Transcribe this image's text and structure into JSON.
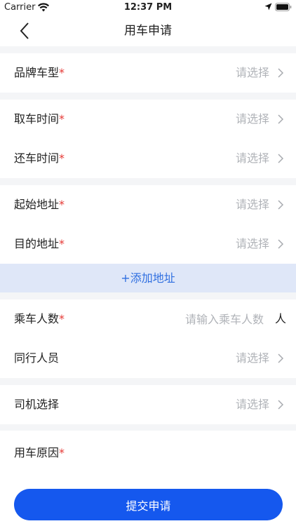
{
  "status_bar": {
    "carrier": "Carrier",
    "time": "12:37 PM"
  },
  "header": {
    "title": "用车申请"
  },
  "colors": {
    "accent": "#1558ee",
    "required": "#e53935",
    "add_address_bg": "#dfe7f8",
    "add_address_text": "#2f6fe0",
    "placeholder": "#b0b3b8"
  },
  "form": {
    "brand_model": {
      "label": "品牌车型",
      "required_mark": "*",
      "value": "请选择"
    },
    "pickup_time": {
      "label": "取车时间",
      "required_mark": "*",
      "value": "请选择"
    },
    "return_time": {
      "label": "还车时间",
      "required_mark": "*",
      "value": "请选择"
    },
    "start_address": {
      "label": "起始地址",
      "required_mark": "*",
      "value": "请选择"
    },
    "destination": {
      "label": "目的地址",
      "required_mark": "*",
      "value": "请选择"
    },
    "add_address_label": "+添加地址",
    "passenger_count": {
      "label": "乘车人数",
      "required_mark": "*",
      "placeholder": "请输入乘车人数",
      "unit": "人"
    },
    "companions": {
      "label": "同行人员",
      "value": "请选择"
    },
    "driver": {
      "label": "司机选择",
      "value": "请选择"
    },
    "reason": {
      "label": "用车原因",
      "required_mark": "*"
    }
  },
  "footer": {
    "submit_label": "提交申请"
  }
}
